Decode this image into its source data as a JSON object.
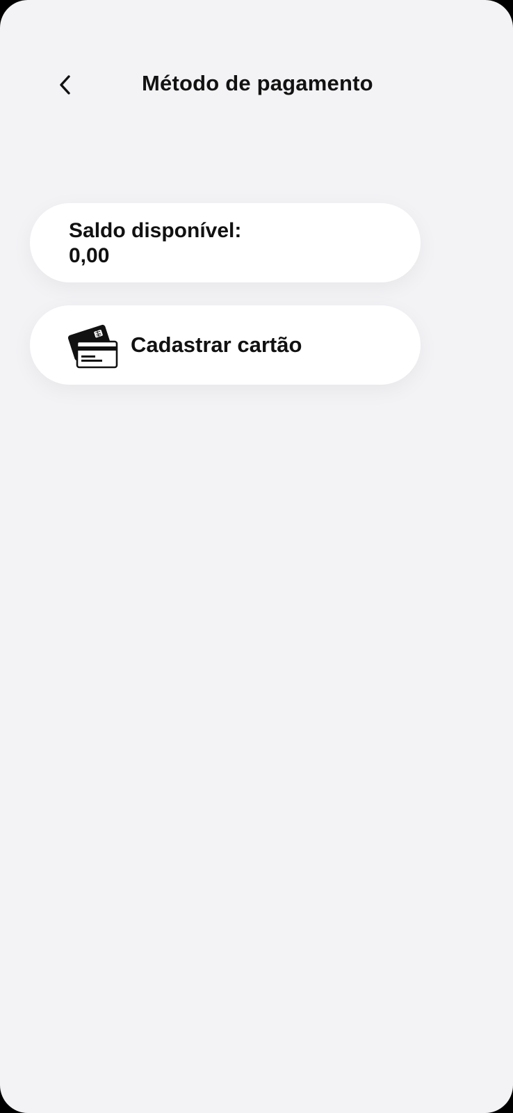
{
  "header": {
    "title": "Método de pagamento",
    "back_icon": "chevron-left-icon"
  },
  "balance": {
    "label": "Saldo disponível:",
    "value": "0,00"
  },
  "register_card": {
    "label": "Cadastrar cartão",
    "icon": "credit-cards-icon"
  },
  "colors": {
    "background": "#f3f3f6",
    "card": "#ffffff",
    "text": "#111111"
  }
}
